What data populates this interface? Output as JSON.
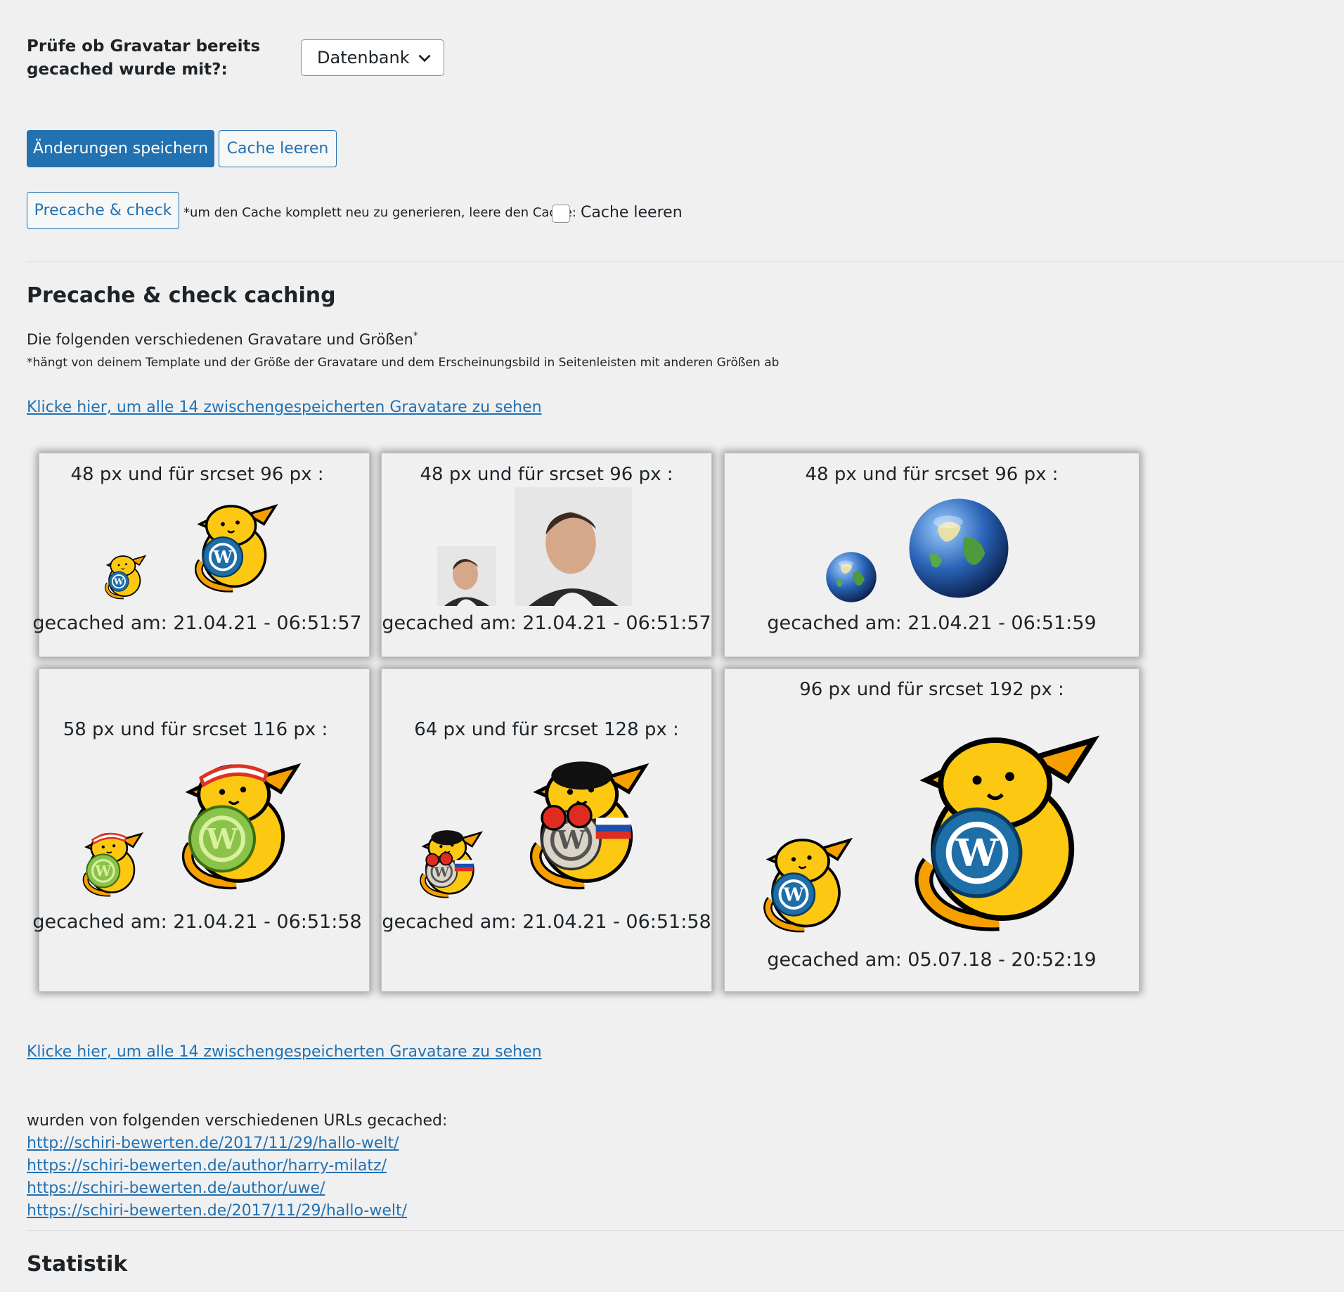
{
  "setting": {
    "label": "Prüfe ob Gravatar bereits gecached wurde mit?:",
    "select_value": "Datenbank"
  },
  "buttons": {
    "save": "Änderungen speichern",
    "clear_cache": "Cache leeren",
    "precache": "Precache & check"
  },
  "precache_note": "*um den Cache komplett neu zu generieren, leere den Cache:",
  "checkbox_label": "Cache leeren",
  "section": {
    "title": "Precache & check caching",
    "description": "Die folgenden verschiedenen Gravatare und Größen",
    "description_mark": "*",
    "footnote": "*hängt von deinem Template und der Größe der Gravatare und dem Erscheinungsbild in Seitenleisten mit anderen Größen ab",
    "view_all_link": "Klicke hier, um alle 14 zwischengespeicherten Gravatare zu sehen"
  },
  "cards": [
    {
      "title": "48 px und für srcset 96 px :",
      "date": "gecached am: 21.04.21 - 06:51:57",
      "avatar": "wapuu-wordpress"
    },
    {
      "title": "48 px und für srcset 96 px :",
      "date": "gecached am: 21.04.21 - 06:51:57",
      "avatar": "photo-man"
    },
    {
      "title": "48 px und für srcset 96 px :",
      "date": "gecached am: 21.04.21 - 06:51:59",
      "avatar": "earth-globe"
    },
    {
      "title": "58 px und für srcset 116 px :",
      "date": "gecached am: 21.04.21 - 06:51:58",
      "avatar": "wapuu-tennis"
    },
    {
      "title": "64 px und für srcset 128 px :",
      "date": "gecached am: 21.04.21 - 06:51:58",
      "avatar": "wapuu-boxer"
    },
    {
      "title": "96 px und für srcset 192 px :",
      "date": "gecached am: 05.07.18 - 20:52:19",
      "avatar": "wapuu-wordpress"
    }
  ],
  "urls": {
    "heading": "wurden von folgenden verschiedenen URLs gecached:",
    "items": [
      "http://schiri-bewerten.de/2017/11/29/hallo-welt/",
      "https://schiri-bewerten.de/author/harry-milatz/",
      "https://schiri-bewerten.de/author/uwe/",
      "https://schiri-bewerten.de/2017/11/29/hallo-welt/"
    ]
  },
  "statistik_title": "Statistik",
  "colors": {
    "accent": "#2271b1",
    "background": "#f0f0f1",
    "text": "#1d2327",
    "wapuu_yellow": "#fcc811",
    "wapuu_orange": "#f5a000",
    "wp_blue": "#1e6ea8"
  }
}
